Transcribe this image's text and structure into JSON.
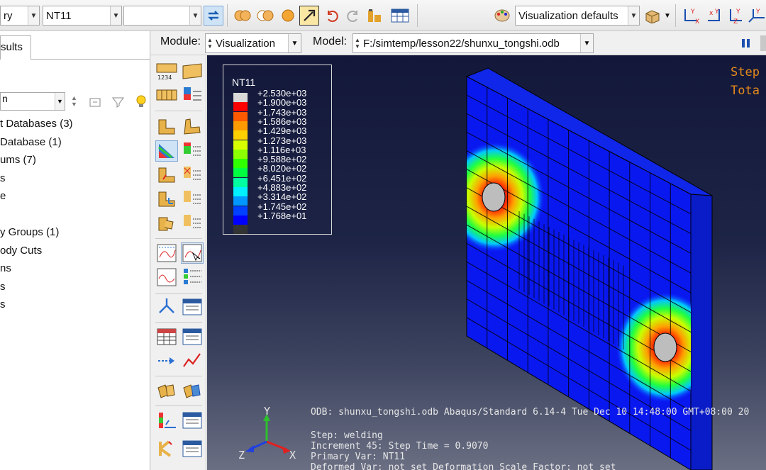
{
  "toolbar": {
    "combo1_value": "ry",
    "combo2_value": "NT11",
    "combo3_value": "",
    "viz_defaults": "Visualization defaults"
  },
  "module_bar": {
    "module_label": "Module:",
    "module_value": "Visualization",
    "model_label": "Model:",
    "model_value": "F:/simtemp/lesson22/shunxu_tongshi.odb"
  },
  "left_panel": {
    "tab_label": "sults",
    "filter_value": "n",
    "tree": [
      "t Databases (3)",
      " Database (1)",
      "ums (7)",
      "s",
      "e",
      "",
      "y Groups (1)",
      "ody Cuts",
      "ns",
      "s",
      "s"
    ]
  },
  "legend": {
    "title": "NT11",
    "entries": [
      {
        "label": "+2.530e+03",
        "color": "#d9d9d9"
      },
      {
        "label": "+1.900e+03",
        "color": "#ff0000"
      },
      {
        "label": "+1.743e+03",
        "color": "#ff5a00"
      },
      {
        "label": "+1.586e+03",
        "color": "#ff9a00"
      },
      {
        "label": "+1.429e+03",
        "color": "#ffd000"
      },
      {
        "label": "+1.273e+03",
        "color": "#d8ff00"
      },
      {
        "label": "+1.116e+03",
        "color": "#8cff00"
      },
      {
        "label": "+9.588e+02",
        "color": "#30ff00"
      },
      {
        "label": "+8.020e+02",
        "color": "#00ff40"
      },
      {
        "label": "+6.451e+02",
        "color": "#00ffa0"
      },
      {
        "label": "+4.883e+02",
        "color": "#00f0ff"
      },
      {
        "label": "+3.314e+02",
        "color": "#0098ff"
      },
      {
        "label": "+1.745e+02",
        "color": "#0040ff"
      },
      {
        "label": "+1.768e+01",
        "color": "#0000ff"
      },
      {
        "label": "",
        "color": "#333333"
      }
    ]
  },
  "viewport": {
    "step_label": "Step",
    "total_label": "Tota",
    "odb_line": "ODB: shunxu_tongshi.odb    Abaqus/Standard 6.14-4    Tue Dec 10 14:48:00 GMT+08:00 20",
    "step_line": "Step: welding",
    "increment_line": "Increment     45: Step Time =    0.9070",
    "primary_var_line": "Primary Var: NT11",
    "deformed_line": "Deformed Var: not set   Deformation Scale Factor: not set",
    "triad": {
      "x": "X",
      "y": "Y",
      "z": "Z"
    }
  }
}
